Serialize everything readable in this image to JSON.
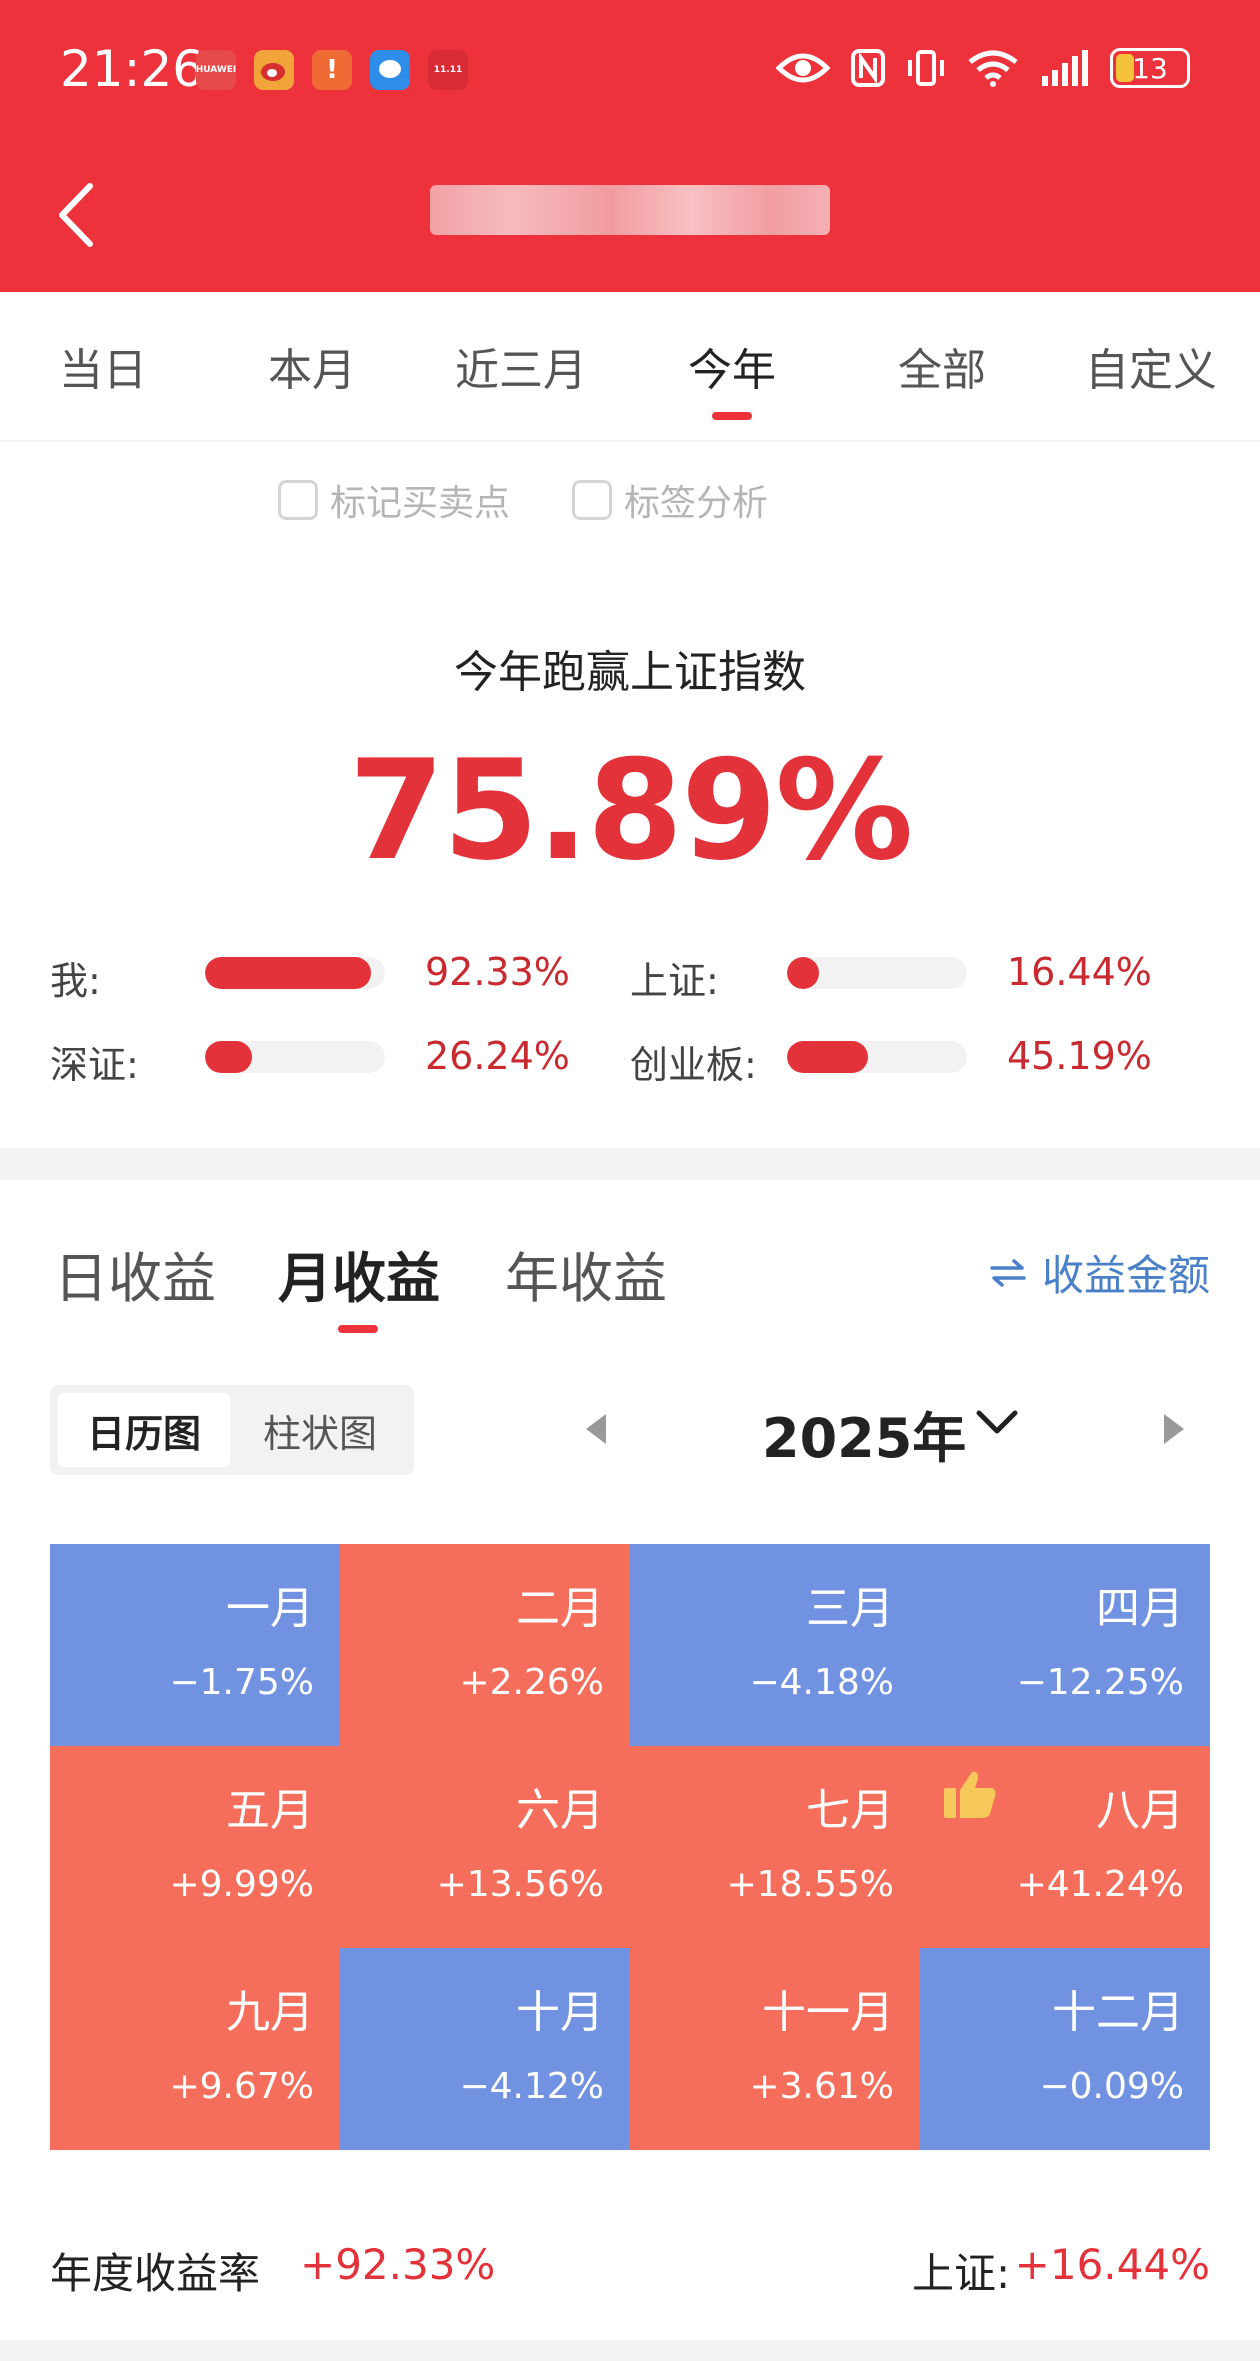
{
  "status": {
    "time": "21:26",
    "apps": [
      {
        "name": "huawei-app-icon",
        "color": "#e74a4a",
        "text": "HUAWEI"
      },
      {
        "name": "weibo-app-icon",
        "color": "#f1a43a",
        "text": ""
      },
      {
        "name": "alert-app-icon",
        "color": "#f06a36",
        "text": "!"
      },
      {
        "name": "message-app-icon",
        "color": "#2e8de8",
        "text": ""
      },
      {
        "name": "jd-app-icon",
        "color": "#d92b35",
        "text": "11.11"
      }
    ],
    "battery": "13"
  },
  "tabs": [
    "当日",
    "本月",
    "近三月",
    "今年",
    "全部",
    "自定义"
  ],
  "active_tab": "今年",
  "options": {
    "mark": "标记买卖点",
    "tag": "标签分析"
  },
  "summary": {
    "title": "今年跑赢上证指数",
    "value": "75.89%"
  },
  "comparisons": [
    {
      "label": "我:",
      "value": "92.33%",
      "fill": 0.92
    },
    {
      "label": "上证:",
      "value": "16.44%",
      "fill": 0.16
    },
    {
      "label": "深证:",
      "value": "26.24%",
      "fill": 0.26
    },
    {
      "label": "创业板:",
      "value": "45.19%",
      "fill": 0.45
    }
  ],
  "returns_tabs": [
    "日收益",
    "月收益",
    "年收益"
  ],
  "active_returns_tab": "月收益",
  "amount_toggle": "收益金额",
  "view_mode": [
    "日历图",
    "柱状图"
  ],
  "year": "2025年",
  "months": [
    {
      "month": "一月",
      "value": "−1.75%",
      "color": "#7092e0"
    },
    {
      "month": "二月",
      "value": "+2.26%",
      "color": "#f56e5c"
    },
    {
      "month": "三月",
      "value": "−4.18%",
      "color": "#7092e0"
    },
    {
      "month": "四月",
      "value": "−12.25%",
      "color": "#7092e0"
    },
    {
      "month": "五月",
      "value": "+9.99%",
      "color": "#f56e5c"
    },
    {
      "month": "六月",
      "value": "+13.56%",
      "color": "#f56e5c"
    },
    {
      "month": "七月",
      "value": "+18.55%",
      "color": "#f56e5c"
    },
    {
      "month": "八月",
      "value": "+41.24%",
      "color": "#f56e5c",
      "badge": "thumbs-up-icon"
    },
    {
      "month": "九月",
      "value": "+9.67%",
      "color": "#f56e5c"
    },
    {
      "month": "十月",
      "value": "−4.12%",
      "color": "#7092e0"
    },
    {
      "month": "十一月",
      "value": "+3.61%",
      "color": "#f56e5c"
    },
    {
      "month": "十二月",
      "value": "−0.09%",
      "color": "#7092e0"
    }
  ],
  "footer": {
    "annual_label": "年度收益率",
    "annual_value": "+92.33%",
    "index_label": "上证:",
    "index_value": "+16.44%"
  }
}
